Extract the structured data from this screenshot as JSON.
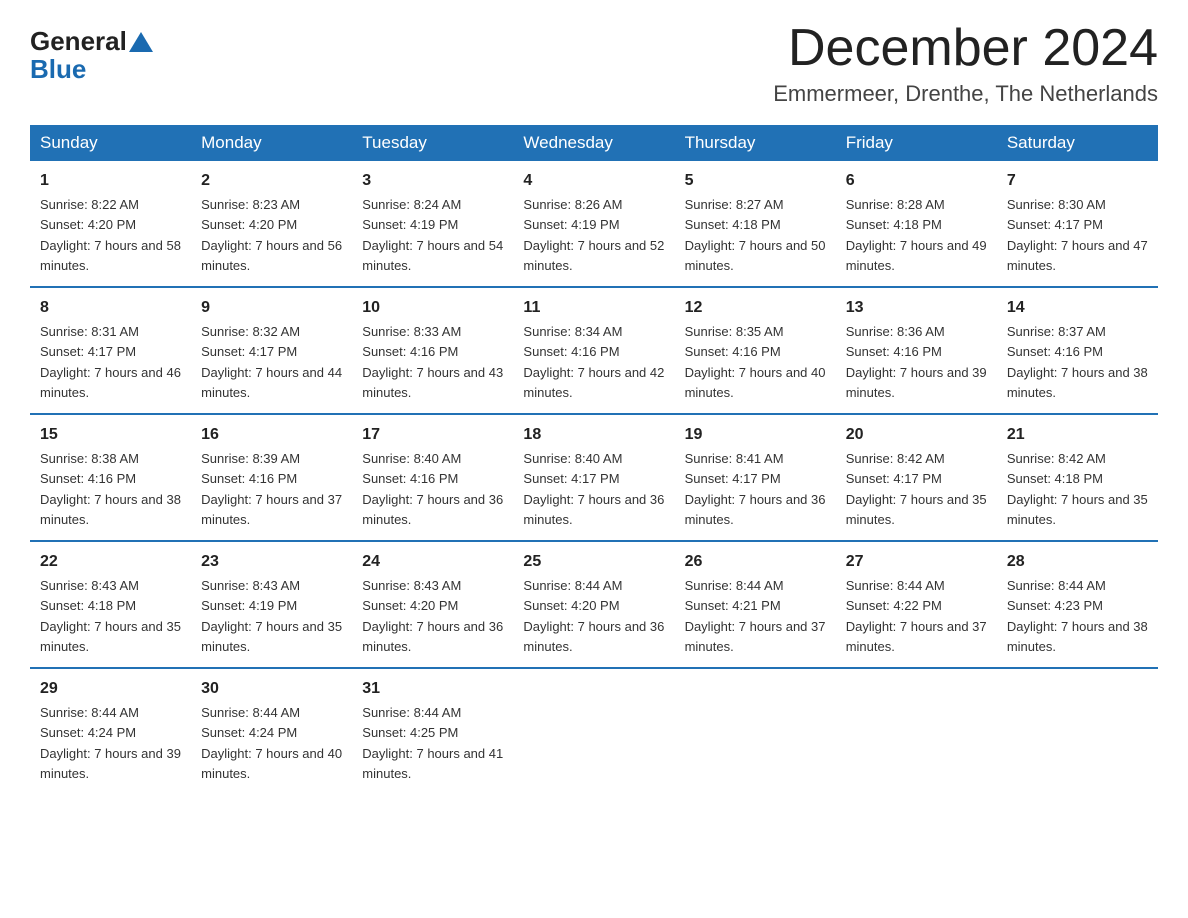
{
  "logo": {
    "general": "General",
    "blue": "Blue"
  },
  "title": "December 2024",
  "location": "Emmermeer, Drenthe, The Netherlands",
  "header_days": [
    "Sunday",
    "Monday",
    "Tuesday",
    "Wednesday",
    "Thursday",
    "Friday",
    "Saturday"
  ],
  "weeks": [
    [
      {
        "day": "1",
        "sunrise": "8:22 AM",
        "sunset": "4:20 PM",
        "daylight": "7 hours and 58 minutes."
      },
      {
        "day": "2",
        "sunrise": "8:23 AM",
        "sunset": "4:20 PM",
        "daylight": "7 hours and 56 minutes."
      },
      {
        "day": "3",
        "sunrise": "8:24 AM",
        "sunset": "4:19 PM",
        "daylight": "7 hours and 54 minutes."
      },
      {
        "day": "4",
        "sunrise": "8:26 AM",
        "sunset": "4:19 PM",
        "daylight": "7 hours and 52 minutes."
      },
      {
        "day": "5",
        "sunrise": "8:27 AM",
        "sunset": "4:18 PM",
        "daylight": "7 hours and 50 minutes."
      },
      {
        "day": "6",
        "sunrise": "8:28 AM",
        "sunset": "4:18 PM",
        "daylight": "7 hours and 49 minutes."
      },
      {
        "day": "7",
        "sunrise": "8:30 AM",
        "sunset": "4:17 PM",
        "daylight": "7 hours and 47 minutes."
      }
    ],
    [
      {
        "day": "8",
        "sunrise": "8:31 AM",
        "sunset": "4:17 PM",
        "daylight": "7 hours and 46 minutes."
      },
      {
        "day": "9",
        "sunrise": "8:32 AM",
        "sunset": "4:17 PM",
        "daylight": "7 hours and 44 minutes."
      },
      {
        "day": "10",
        "sunrise": "8:33 AM",
        "sunset": "4:16 PM",
        "daylight": "7 hours and 43 minutes."
      },
      {
        "day": "11",
        "sunrise": "8:34 AM",
        "sunset": "4:16 PM",
        "daylight": "7 hours and 42 minutes."
      },
      {
        "day": "12",
        "sunrise": "8:35 AM",
        "sunset": "4:16 PM",
        "daylight": "7 hours and 40 minutes."
      },
      {
        "day": "13",
        "sunrise": "8:36 AM",
        "sunset": "4:16 PM",
        "daylight": "7 hours and 39 minutes."
      },
      {
        "day": "14",
        "sunrise": "8:37 AM",
        "sunset": "4:16 PM",
        "daylight": "7 hours and 38 minutes."
      }
    ],
    [
      {
        "day": "15",
        "sunrise": "8:38 AM",
        "sunset": "4:16 PM",
        "daylight": "7 hours and 38 minutes."
      },
      {
        "day": "16",
        "sunrise": "8:39 AM",
        "sunset": "4:16 PM",
        "daylight": "7 hours and 37 minutes."
      },
      {
        "day": "17",
        "sunrise": "8:40 AM",
        "sunset": "4:16 PM",
        "daylight": "7 hours and 36 minutes."
      },
      {
        "day": "18",
        "sunrise": "8:40 AM",
        "sunset": "4:17 PM",
        "daylight": "7 hours and 36 minutes."
      },
      {
        "day": "19",
        "sunrise": "8:41 AM",
        "sunset": "4:17 PM",
        "daylight": "7 hours and 36 minutes."
      },
      {
        "day": "20",
        "sunrise": "8:42 AM",
        "sunset": "4:17 PM",
        "daylight": "7 hours and 35 minutes."
      },
      {
        "day": "21",
        "sunrise": "8:42 AM",
        "sunset": "4:18 PM",
        "daylight": "7 hours and 35 minutes."
      }
    ],
    [
      {
        "day": "22",
        "sunrise": "8:43 AM",
        "sunset": "4:18 PM",
        "daylight": "7 hours and 35 minutes."
      },
      {
        "day": "23",
        "sunrise": "8:43 AM",
        "sunset": "4:19 PM",
        "daylight": "7 hours and 35 minutes."
      },
      {
        "day": "24",
        "sunrise": "8:43 AM",
        "sunset": "4:20 PM",
        "daylight": "7 hours and 36 minutes."
      },
      {
        "day": "25",
        "sunrise": "8:44 AM",
        "sunset": "4:20 PM",
        "daylight": "7 hours and 36 minutes."
      },
      {
        "day": "26",
        "sunrise": "8:44 AM",
        "sunset": "4:21 PM",
        "daylight": "7 hours and 37 minutes."
      },
      {
        "day": "27",
        "sunrise": "8:44 AM",
        "sunset": "4:22 PM",
        "daylight": "7 hours and 37 minutes."
      },
      {
        "day": "28",
        "sunrise": "8:44 AM",
        "sunset": "4:23 PM",
        "daylight": "7 hours and 38 minutes."
      }
    ],
    [
      {
        "day": "29",
        "sunrise": "8:44 AM",
        "sunset": "4:24 PM",
        "daylight": "7 hours and 39 minutes."
      },
      {
        "day": "30",
        "sunrise": "8:44 AM",
        "sunset": "4:24 PM",
        "daylight": "7 hours and 40 minutes."
      },
      {
        "day": "31",
        "sunrise": "8:44 AM",
        "sunset": "4:25 PM",
        "daylight": "7 hours and 41 minutes."
      },
      null,
      null,
      null,
      null
    ]
  ]
}
